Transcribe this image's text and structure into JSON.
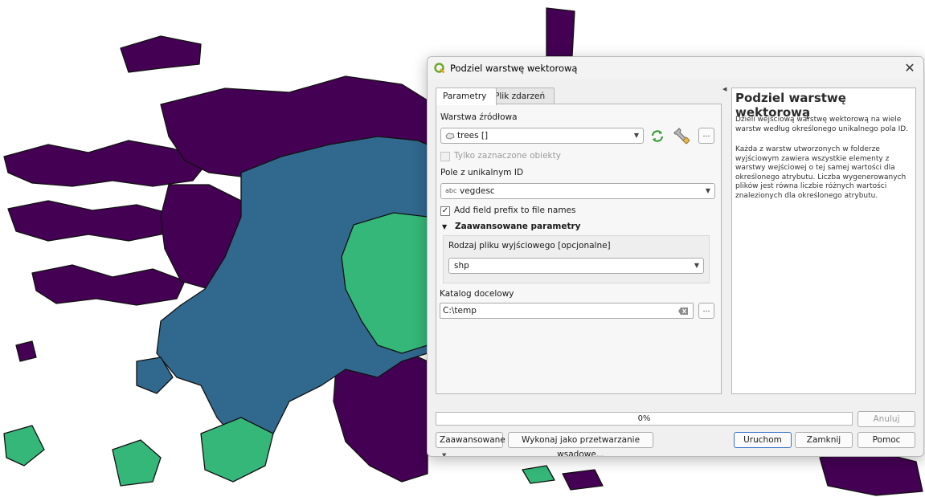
{
  "dialog": {
    "title": "Podziel warstwę wektorową",
    "close_glyph": "✕"
  },
  "tabs": [
    {
      "label": "Parametry",
      "active": true
    },
    {
      "label": "Plik zdarzeń",
      "active": false
    }
  ],
  "params": {
    "source_label": "Warstwa źródłowa",
    "source_value": "trees []",
    "selected_only_label": "Tylko zaznaczone obiekty",
    "selected_only_checked": false,
    "unique_field_label": "Pole z unikalnym ID",
    "unique_field_type": "abc",
    "unique_field_value": "vegdesc",
    "prefix_label": "Add field prefix to file names",
    "prefix_checked": true,
    "advanced_header": "Zaawansowane parametry",
    "output_type_label": "Rodzaj pliku wyjściowego [opcjonalne]",
    "output_type_value": "shp",
    "dest_label": "Katalog docelowy",
    "dest_value": "C:\\temp",
    "ellipsis": "…"
  },
  "help": {
    "title": "Podziel warstwę wektorową",
    "para1": "Dzieli wejściową warstwę wektorową na wiele warstw według określonego unikalnego pola ID.",
    "para2": "Każda z warstw utworzonych w folderze wyjściowym zawiera wszystkie elementy z warstwy wejściowej o tej samej wartości dla określonego atrybutu. Liczba wygenerowanych plików jest równa liczbie różnych wartości znalezionych dla określonego atrybutu."
  },
  "progress": {
    "text": "0%",
    "value": 0
  },
  "buttons": {
    "cancel": "Anuluj",
    "advanced": "Zaawansowane",
    "batch": "Wykonaj jako przetwarzanie wsadowe...",
    "run": "Uruchom",
    "close": "Zamknij",
    "help": "Pomoc"
  },
  "map_colors": {
    "purple": "#440154",
    "blue": "#31688e",
    "green": "#35b779"
  }
}
